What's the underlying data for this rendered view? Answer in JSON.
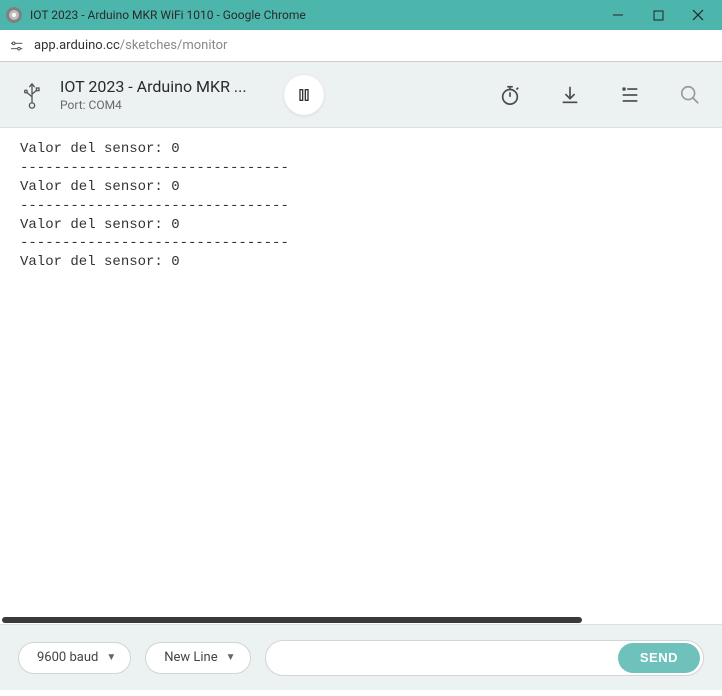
{
  "titlebar": {
    "title": "IOT 2023 - Arduino MKR WiFi 1010 - Google Chrome"
  },
  "addressbar": {
    "host": "app.arduino.cc",
    "path": "/sketches/monitor"
  },
  "header": {
    "title": "IOT 2023 - Arduino MKR ...",
    "port_label": "Port: COM4"
  },
  "console": {
    "lines": [
      "Valor del sensor: 0",
      "",
      "--------------------------------",
      "Valor del sensor: 0",
      "",
      "--------------------------------",
      "Valor del sensor: 0",
      "",
      "--------------------------------",
      "Valor del sensor: 0"
    ]
  },
  "bottombar": {
    "baud_label": "9600 baud",
    "lineending_label": "New Line",
    "send_placeholder": "",
    "send_button": "SEND"
  }
}
